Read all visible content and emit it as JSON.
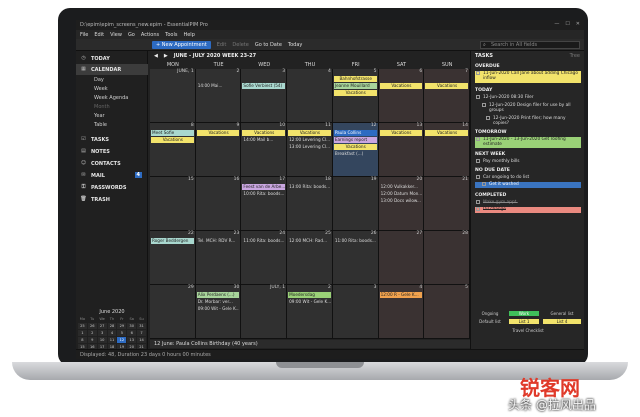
{
  "window": {
    "title": "D:\\epim\\epim_screens_new.epim - EssentialPIM Pro",
    "min": "—",
    "max": "☐",
    "close": "✕"
  },
  "menu": [
    "File",
    "Edit",
    "View",
    "Go",
    "Actions",
    "Tools",
    "Help"
  ],
  "toolbar": {
    "new": "+ New Appointment",
    "edit": "Edit",
    "delete": "Delete",
    "goto": "Go to Date",
    "today": "Today",
    "search_placeholder": "Search in All fields"
  },
  "sidebar": {
    "today": "TODAY",
    "calendar": "CALENDAR",
    "calendar_views": [
      "Day",
      "Week",
      "Week Agenda",
      "Month",
      "Year",
      "Table"
    ],
    "tasks": "TASKS",
    "notes": "NOTES",
    "contacts": "CONTACTS",
    "mail": "MAIL",
    "mail_count": "4",
    "passwords": "PASSWORDS",
    "trash": "TRASH"
  },
  "mini_calendar": {
    "title": "June 2020",
    "days": [
      "Mo",
      "Tu",
      "We",
      "Th",
      "Fr",
      "Sa",
      "Su"
    ],
    "dates": [
      "25",
      "26",
      "27",
      "28",
      "29",
      "30",
      "31",
      "1",
      "2",
      "3",
      "4",
      "5",
      "6",
      "7",
      "8",
      "9",
      "10",
      "11",
      "12",
      "13",
      "14",
      "15",
      "16",
      "17",
      "18",
      "19",
      "20",
      "21",
      "22",
      "23",
      "24",
      "25",
      "26",
      "27",
      "28",
      "29",
      "30",
      "1",
      "2",
      "3",
      "4",
      "5"
    ],
    "today_index": 18
  },
  "calendar": {
    "range": "JUNE - JULY 2020   WEEK 23-27",
    "days": [
      "MON",
      "TUE",
      "WED",
      "THU",
      "FRI",
      "SAT",
      "SUN"
    ],
    "weeks": [
      [
        "JUNE, 1",
        "2",
        "3",
        "4",
        "5",
        "6",
        "7"
      ],
      [
        "8",
        "9",
        "10",
        "11",
        "12",
        "13",
        "14"
      ],
      [
        "15",
        "16",
        "17",
        "18",
        "19",
        "20",
        "21"
      ],
      [
        "22",
        "23",
        "24",
        "25",
        "26",
        "27",
        "28"
      ],
      [
        "29",
        "30",
        "JULY, 1",
        "2",
        "3",
        "4",
        "5"
      ]
    ],
    "events": {
      "w0": {
        "tue": "14:00 Mai...",
        "wed": "Sofie Verbiest (54)",
        "fri1": "Bahnhofstrasse",
        "fri2": "Jeanne Mouillard",
        "fri3": "Vacations",
        "sat": "Vacations",
        "sun": "Vacations"
      },
      "w1": {
        "mon1": "Meet Sofie",
        "mon2": "Vacations",
        "tue": "Vacations",
        "wed1": "Vacations",
        "wed2": "14:00 Mail b...",
        "thu1": "Vacations",
        "thu2": "12:00 Levering Cl...",
        "thu3": "13:00 Levering Cl...",
        "fri1": "Paula Collins",
        "fri2": "Earnings report",
        "fri3": "Vacations",
        "fri4": "Breakfast (...)",
        "sat": "Vacations",
        "sun": "Vacations"
      },
      "w2": {
        "wed1": "Feest van de Arbe...",
        "wed2": "10:00 Rita: boods...",
        "thu": "13:00 Rita: boods...",
        "sat1": "12:00 Vulkakker...",
        "sat2": "12:00 Datum Mon...",
        "sat3": "13:00 Docs wilow..."
      },
      "w3": {
        "mon": "Roger Beddergen",
        "tue": "Tel. MCH: RDV R...",
        "wed": "11:00 Rita: boods...",
        "thu": "12:00 MCH: Rad...",
        "fri": "11:00 Rita: boods..."
      },
      "w4": {
        "tue1": "Alix Perdaens (...)",
        "tue2": "Dr. Morbar: ver...",
        "tue3": "09:00 Wit - Gele K...",
        "thu1": "Moedersdag",
        "thu2": "09:00 Wit - Gele K...",
        "sat": "12:00 R - Gele K..."
      }
    },
    "birthday_line": "12 June:  Paula Collins Birthday  (40 years)"
  },
  "tasks": {
    "title": "TASKS",
    "tree": "Tree",
    "overdue": "OVERDUE",
    "overdue_item": "11-Jun-2020  Call Jane about adding Chicago inflow",
    "today": "TODAY",
    "today_items": [
      "12-Jun-2020 08:30 Filer",
      "12-Jun-2020  Design filer for use by all groups",
      "12-Jun-2020  Print filer; how many copies?"
    ],
    "tomorrow": "TOMORROW",
    "tomorrow_item": "11-Jun-2020 - 13-Jun-2020  Get roofing estimate",
    "next_week": "NEXT WEEK",
    "next_week_item": "Pay monthly bills",
    "no_due": "NO DUE DATE",
    "no_due_items": [
      "Car ongoing to do list",
      "Get it washed"
    ],
    "completed": "COMPLETED",
    "completed_items": [
      "Make gym appt.",
      "Oil change"
    ],
    "tabs": [
      "Ongoing",
      "Work",
      "General list",
      "Default list",
      "List 1",
      "List 4",
      "Travel Checklist"
    ]
  },
  "status": "Displayed: 48, Duration 23 days 0 hours 00 minutes",
  "watermark": {
    "big": "锐客网",
    "small": "头条 @拉风出品"
  }
}
